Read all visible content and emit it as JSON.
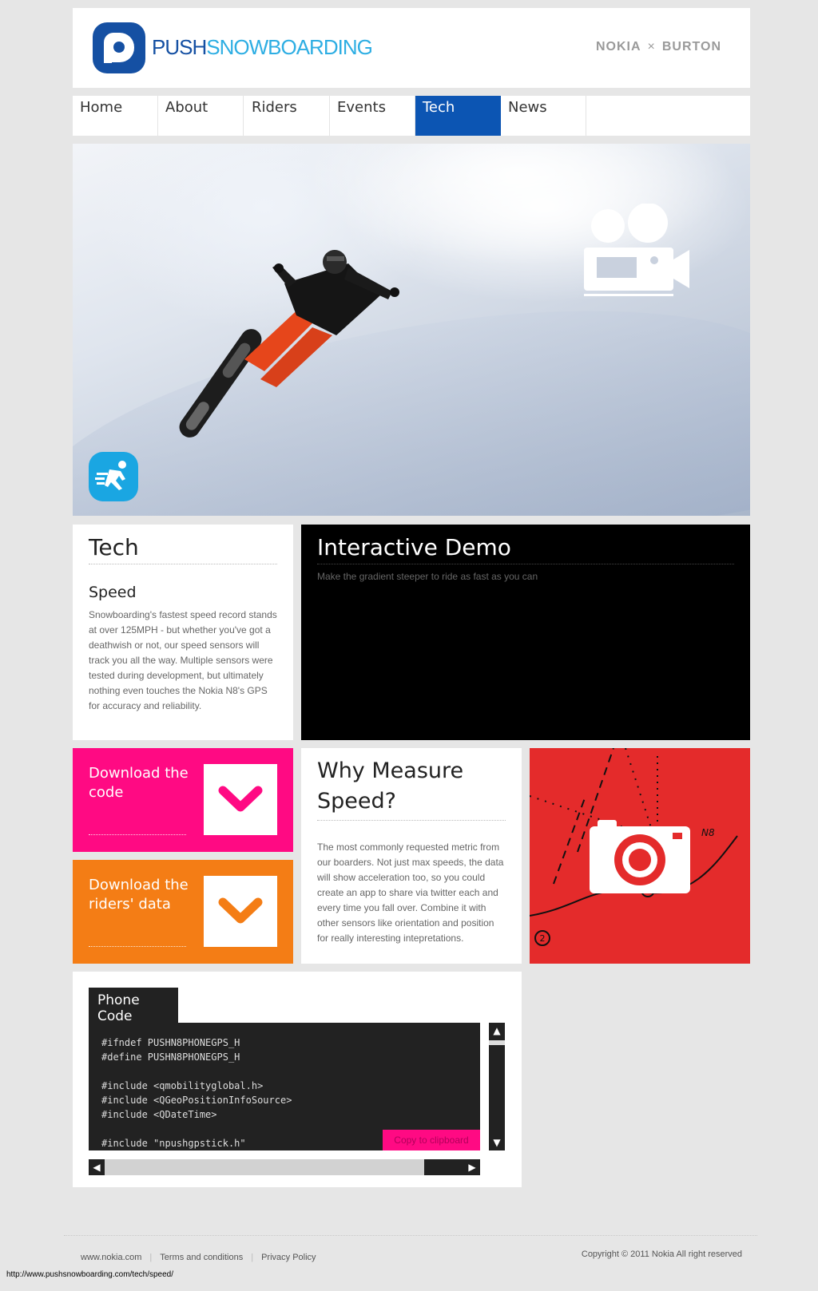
{
  "header": {
    "logo_push": "PUSH",
    "logo_snow": "SNOWBOARDING",
    "partner_left": "NOKIA",
    "partner_x": "×",
    "partner_right": "BURTON"
  },
  "nav": [
    {
      "label": "Home"
    },
    {
      "label": "About"
    },
    {
      "label": "Riders"
    },
    {
      "label": "Events"
    },
    {
      "label": "Tech",
      "active": true
    },
    {
      "label": "News"
    }
  ],
  "tech_card": {
    "title": "Tech",
    "subtitle": "Speed",
    "body": "Snowboarding's fastest speed record stands at over 125MPH -  but whether you've got a deathwish or not, our speed sensors will track you all the way.  Multiple sensors were tested during development, but ultimately nothing even touches the Nokia N8's GPS for accuracy and reliability."
  },
  "demo_card": {
    "title": "Interactive Demo",
    "subtitle": "Make the gradient steeper to ride as fast as you can"
  },
  "downloads": {
    "code_label": "Download the code",
    "data_label": "Download the riders' data"
  },
  "why_card": {
    "title": "Why Measure Speed?",
    "body": "The most commonly requested metric from our boarders. Not just max speeds, the data will show acceleration too, so you could create an app to share via twitter each and every time you fall over. Combine it with other sensors like orientation and position for really interesting intepretations."
  },
  "photo_card": {
    "map_label": "N8",
    "marker_1": "1",
    "marker_2": "2"
  },
  "code_panel": {
    "tab_label": "Phone Code",
    "code": "#ifndef PUSHN8PHONEGPS_H\n#define PUSHN8PHONEGPS_H\n\n#include <qmobilityglobal.h>\n#include <QGeoPositionInfoSource>\n#include <QDateTime>\n\n#include \"npushgpstick.h\"",
    "copy_label": "Copy to clipboard"
  },
  "footer": {
    "links": [
      "www.nokia.com",
      "Terms and conditions",
      "Privacy Policy"
    ],
    "separator": "|",
    "copyright": "Copyright © 2011 Nokia All right reserved",
    "status_url": "http://www.pushsnowboarding.com/tech/speed/"
  },
  "colors": {
    "brand_blue": "#1550a3",
    "nav_active": "#0c55b3",
    "pink": "#ff0a83",
    "orange": "#f47d15",
    "red": "#e42b2b",
    "light_blue": "#2eaee3"
  }
}
